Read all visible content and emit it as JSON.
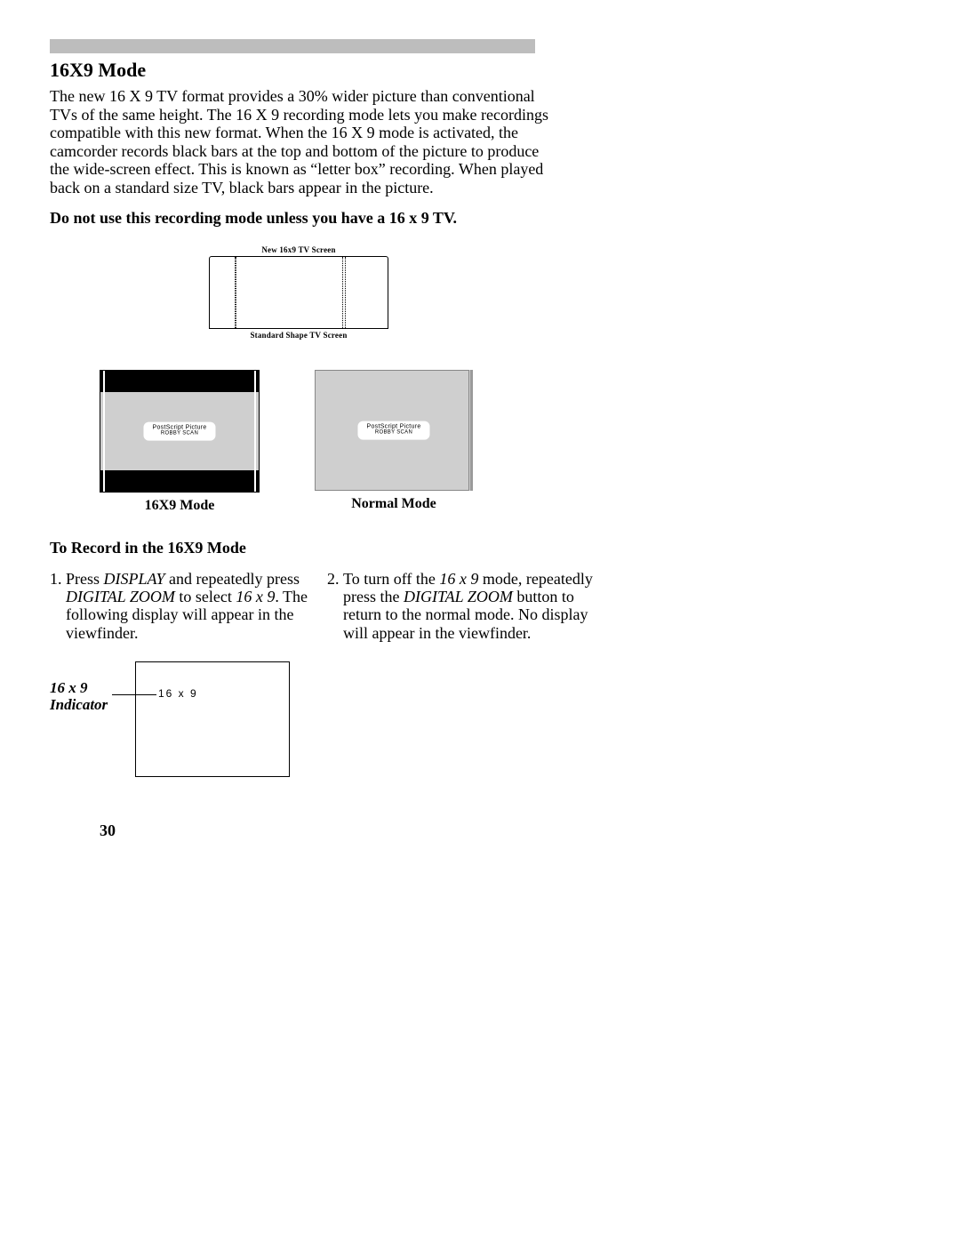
{
  "heading": "16X9 Mode",
  "paragraph": "The new 16 X 9 TV format provides a 30% wider picture than conventional TVs of the same height. The 16 X 9 recording mode lets you make recordings compatible with this new format. When the 16 X 9 mode is activated, the camcorder records black bars at the top and bottom of the picture to produce the wide-screen effect. This is known as “letter box” recording. When played back on a standard size TV, black bars appear in the picture.",
  "bold_note": "Do not use this recording mode unless you have a 16 x 9 TV.",
  "tv_diagram": {
    "top_label": "New 16x9 TV Screen",
    "bottom_label": "Standard Shape TV Screen"
  },
  "mode_figs": {
    "pill_line1": "PostScript Picture",
    "pill_line2": "ROBBY SCAN",
    "caption_left": "16X9 Mode",
    "caption_right": "Normal Mode"
  },
  "subheading": "To Record in the 16X9 Mode",
  "steps": {
    "s1": {
      "num": "1.",
      "pre": "Press ",
      "i1": "DISPLAY",
      "mid1": " and repeatedly press ",
      "i2": "DIGITAL ZOOM",
      "mid2": " to select ",
      "i3": "16 x 9",
      "post": ". The following display will appear in the viewfinder."
    },
    "s2": {
      "num": "2.",
      "pre": "To turn off the ",
      "i1": "16 x 9",
      "mid1": " mode, repeatedly press the ",
      "i2": "DIGITAL ZOOM",
      "post": " button to return to the normal mode. No display will appear in the viewfinder."
    }
  },
  "vf": {
    "label_line1": "16 x 9",
    "label_line2": "Indicator",
    "osd_text": "16  x  9"
  },
  "page_number": "30"
}
